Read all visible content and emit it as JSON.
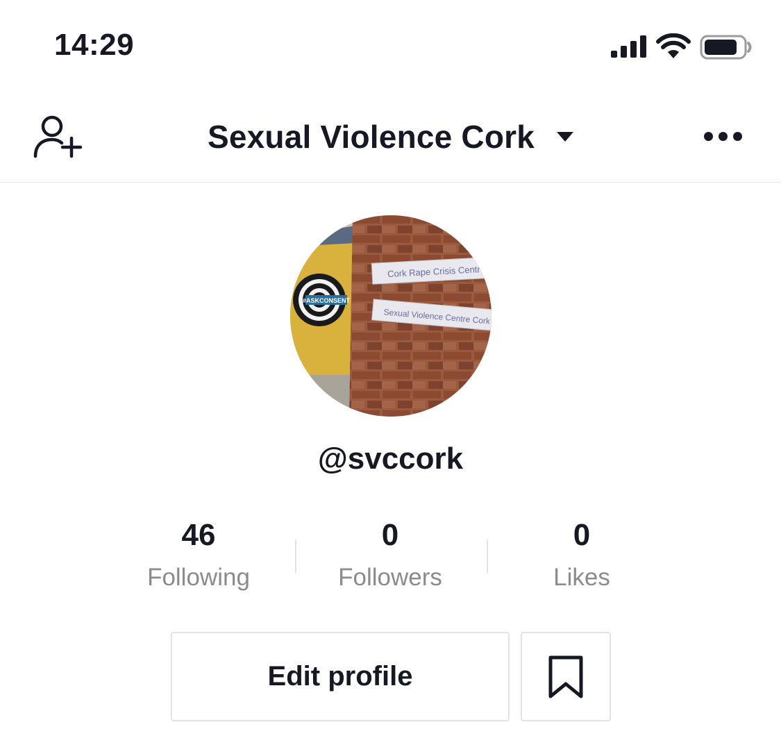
{
  "status_bar": {
    "time": "14:29",
    "icons": [
      "cellular-signal-icon",
      "wifi-icon",
      "battery-icon"
    ]
  },
  "nav": {
    "title": "Sexual Violence Cork",
    "left_icon": "add-user-icon",
    "title_icon": "caret-down-icon",
    "right_icon": "more-options-icon"
  },
  "profile": {
    "avatar_text": {
      "sign1": "Cork Rape Crisis Centre",
      "sign2": "Sexual Violence Centre Cork",
      "badge": "#ASKCONSENT"
    },
    "username": "@svccork"
  },
  "stats": [
    {
      "value": "46",
      "label": "Following"
    },
    {
      "value": "0",
      "label": "Followers"
    },
    {
      "value": "0",
      "label": "Likes"
    }
  ],
  "actions": {
    "edit_profile": "Edit profile",
    "bookmark_icon": "bookmark-icon"
  },
  "colors": {
    "text": "#161823",
    "secondary_text": "#8a8b91",
    "divider": "#e3e3e4"
  }
}
